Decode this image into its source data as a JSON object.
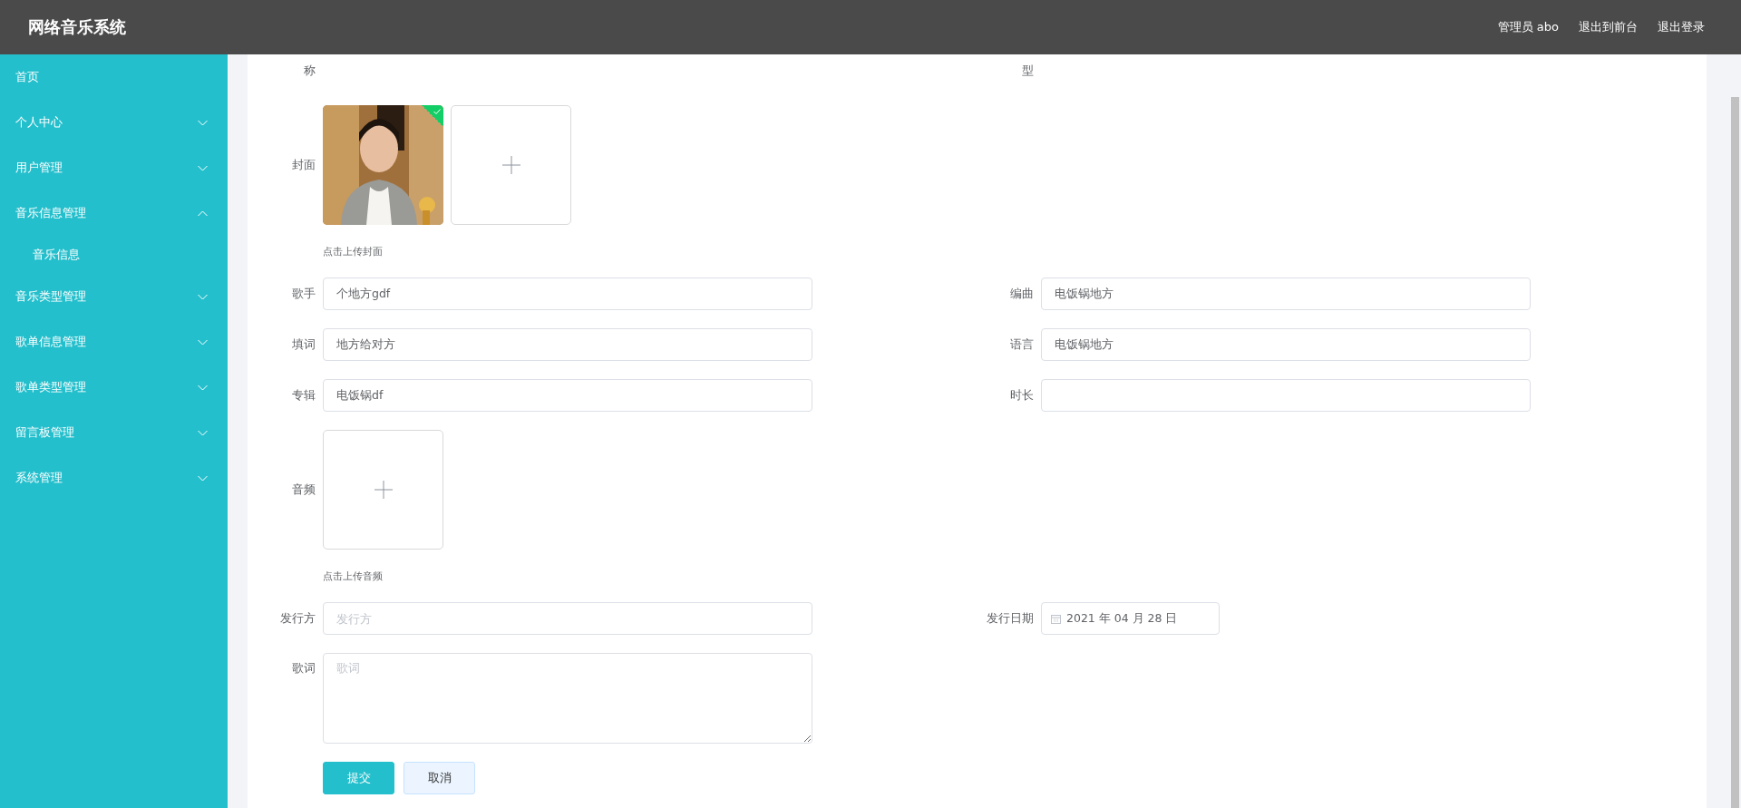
{
  "header": {
    "title": "网络音乐系统",
    "user": "管理员 abo",
    "links": [
      "退出到前台",
      "退出登录"
    ]
  },
  "sidebar": {
    "items": [
      {
        "kind": "link",
        "label": "首页"
      },
      {
        "kind": "menu",
        "label": "个人中心",
        "expanded": false
      },
      {
        "kind": "menu",
        "label": "用户管理",
        "expanded": false
      },
      {
        "kind": "menu",
        "label": "音乐信息管理",
        "expanded": true,
        "children": [
          {
            "label": "音乐信息"
          }
        ]
      },
      {
        "kind": "menu",
        "label": "音乐类型管理",
        "expanded": false
      },
      {
        "kind": "menu",
        "label": "歌单信息管理",
        "expanded": false
      },
      {
        "kind": "menu",
        "label": "歌单类型管理",
        "expanded": false
      },
      {
        "kind": "menu",
        "label": "留言板管理",
        "expanded": false
      },
      {
        "kind": "menu",
        "label": "系统管理",
        "expanded": false
      }
    ]
  },
  "form": {
    "rows": [
      {
        "left": {
          "kind": "cut",
          "label": "称"
        },
        "right": {
          "kind": "cut",
          "label": "型"
        }
      },
      {
        "left": {
          "kind": "image_upload",
          "label": "封面",
          "uploaded": true,
          "hint": "点击上传封面"
        }
      },
      {
        "left": {
          "kind": "text",
          "label": "歌手",
          "value": "个地方gdf"
        },
        "right": {
          "kind": "text",
          "label": "编曲",
          "value": "电饭锅地方"
        }
      },
      {
        "left": {
          "kind": "text",
          "label": "填词",
          "value": "地方给对方"
        },
        "right": {
          "kind": "text",
          "label": "语言",
          "value": "电饭锅地方"
        }
      },
      {
        "left": {
          "kind": "text",
          "label": "专辑",
          "value": "电饭锅df"
        },
        "right": {
          "kind": "text",
          "label": "时长"
        }
      },
      {
        "left": {
          "kind": "file_upload",
          "label": "音频",
          "hint": "点击上传音频"
        }
      },
      {
        "left": {
          "kind": "text",
          "label": "发行方",
          "placeholder": "发行方"
        },
        "right": {
          "kind": "date",
          "label": "发行日期",
          "value": "2021 年 04 月 28 日"
        }
      },
      {
        "left": {
          "kind": "textarea",
          "label": "歌词",
          "placeholder": "歌词"
        }
      }
    ],
    "buttons": [
      {
        "kind": "primary",
        "label": "提交"
      },
      {
        "kind": "default",
        "label": "取消"
      }
    ]
  }
}
